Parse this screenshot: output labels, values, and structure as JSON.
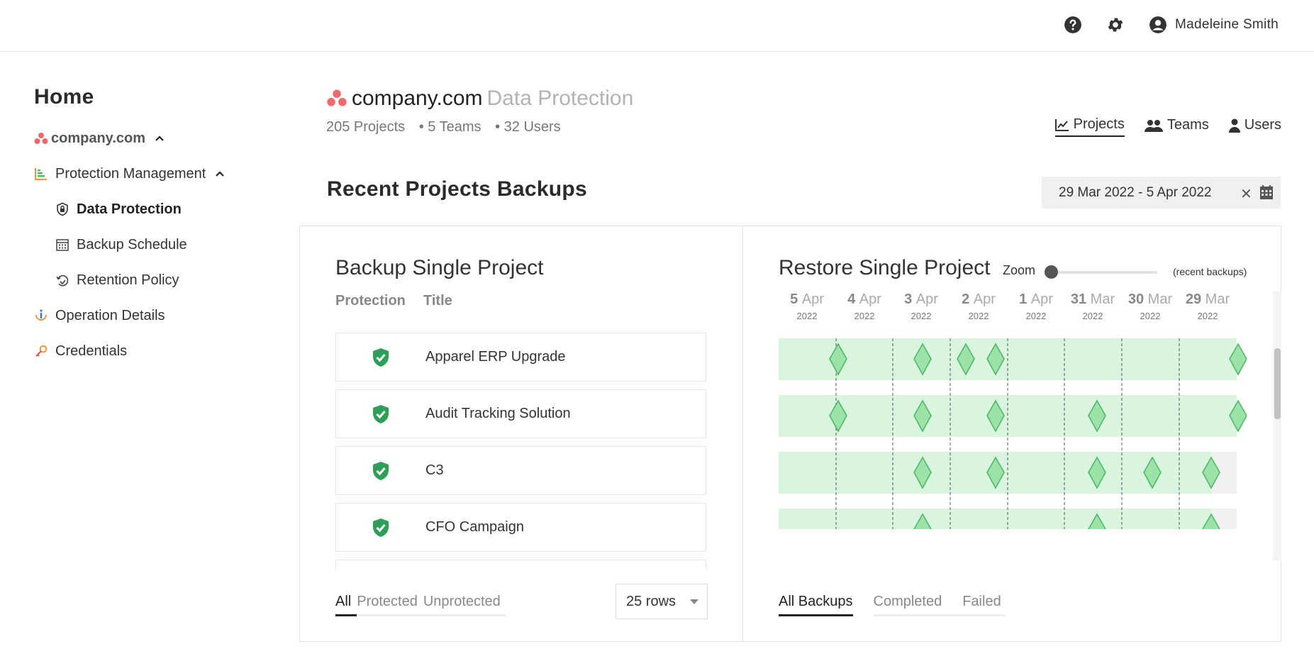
{
  "topbar": {
    "help_icon": "question-circle-icon",
    "settings_icon": "gear-icon",
    "user_icon": "user-circle-icon",
    "user_name": "Madeleine Smith"
  },
  "sidebar": {
    "home": "Home",
    "org": "company.com",
    "items": [
      {
        "label": "Protection Management",
        "icon": "bar-chart-icon"
      },
      {
        "label": "Data Protection",
        "icon": "lock-shield-icon"
      },
      {
        "label": "Backup Schedule",
        "icon": "calendar-icon"
      },
      {
        "label": "Retention Policy",
        "icon": "retention-icon"
      },
      {
        "label": "Operation Details",
        "icon": "info-icon"
      },
      {
        "label": "Credentials",
        "icon": "key-icon"
      }
    ]
  },
  "header": {
    "org": "company.com",
    "section": "Data Protection",
    "projects": "205 Projects",
    "teams": "• 5 Teams",
    "users": "• 32 Users"
  },
  "view_tabs": [
    {
      "label": "Projects",
      "icon": "line-chart-icon",
      "active": true
    },
    {
      "label": "Teams",
      "icon": "team-icon",
      "active": false
    },
    {
      "label": "Users",
      "icon": "user-icon",
      "active": false
    }
  ],
  "section_title": "Recent Projects Backups",
  "date_range": "29 Mar 2022 - 5 Apr 2022",
  "backup_panel": {
    "title": "Backup Single Project",
    "col_protection": "Protection",
    "col_title": "Title",
    "projects": [
      "Apparel ERP Upgrade",
      "Audit Tracking Solution",
      "C3",
      "CFO Campaign"
    ],
    "filters": [
      "All",
      "Protected",
      "Unprotected"
    ],
    "active_filter": "All",
    "rows_per_page": "25 rows"
  },
  "restore_panel": {
    "title": "Restore Single Project",
    "zoom_label": "Zoom",
    "zoom_note": "(recent backups)",
    "dates": [
      {
        "day": "5",
        "month": "Apr",
        "year": "2022"
      },
      {
        "day": "4",
        "month": "Apr",
        "year": "2022"
      },
      {
        "day": "3",
        "month": "Apr",
        "year": "2022"
      },
      {
        "day": "2",
        "month": "Apr",
        "year": "2022"
      },
      {
        "day": "1",
        "month": "Apr",
        "year": "2022"
      },
      {
        "day": "31",
        "month": "Mar",
        "year": "2022"
      },
      {
        "day": "30",
        "month": "Mar",
        "year": "2022"
      },
      {
        "day": "29",
        "month": "Mar",
        "year": "2022"
      }
    ],
    "tabs": [
      "All Backups",
      "Completed",
      "Failed"
    ],
    "active_tab": "All Backups",
    "colors": {
      "band": "#d9f5df",
      "marker_fill": "#9be3a9",
      "marker_stroke": "#4bb562",
      "empty": "#f0f0f0",
      "shield": "#2e9e58"
    }
  }
}
